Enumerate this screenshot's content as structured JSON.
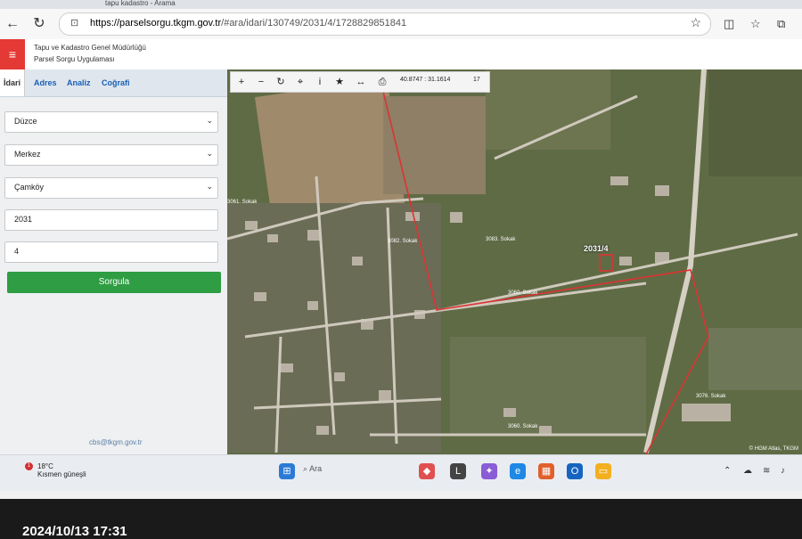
{
  "browser": {
    "tab_text": "tapu kadastro - Arama",
    "url_host": "https://parselsorgu.tkgm.gov.tr",
    "url_path": "/#ara/idari/130749/2031/4/1728829851841"
  },
  "app": {
    "title_line1": "Tapu ve Kadastro Genel Müdürlüğü",
    "title_line2": "Parsel Sorgu Uygulaması"
  },
  "panel": {
    "tabs": [
      "İdari",
      "Adres",
      "Analiz",
      "Coğrafi"
    ],
    "province": "Düzce",
    "district": "Merkez",
    "neighborhood": "Çamköy",
    "block": "2031",
    "parcel": "4",
    "query_label": "Sorgula",
    "email": "cbs@tkgm.gov.tr"
  },
  "map": {
    "coordinates": "40.8747 : 31.1614",
    "zoom": "17",
    "parcel_label": "2031/4",
    "street_labels": [
      "3082. Sokak",
      "3061. Sokak",
      "3083. Sokak",
      "3060. Sokak",
      "3076. Sokak",
      "3060. Sokak"
    ],
    "copyright": "© HGM Atlas, TKGM"
  },
  "taskbar": {
    "temperature": "18°C",
    "weather": "Kısmen güneşli",
    "search_placeholder": "Ara",
    "badge": "1"
  },
  "photo_timestamp": "2024/10/13 17:31",
  "colors": {
    "accent_red": "#e53935",
    "button_green": "#2e9d43",
    "link_blue": "#1a5fb4"
  }
}
